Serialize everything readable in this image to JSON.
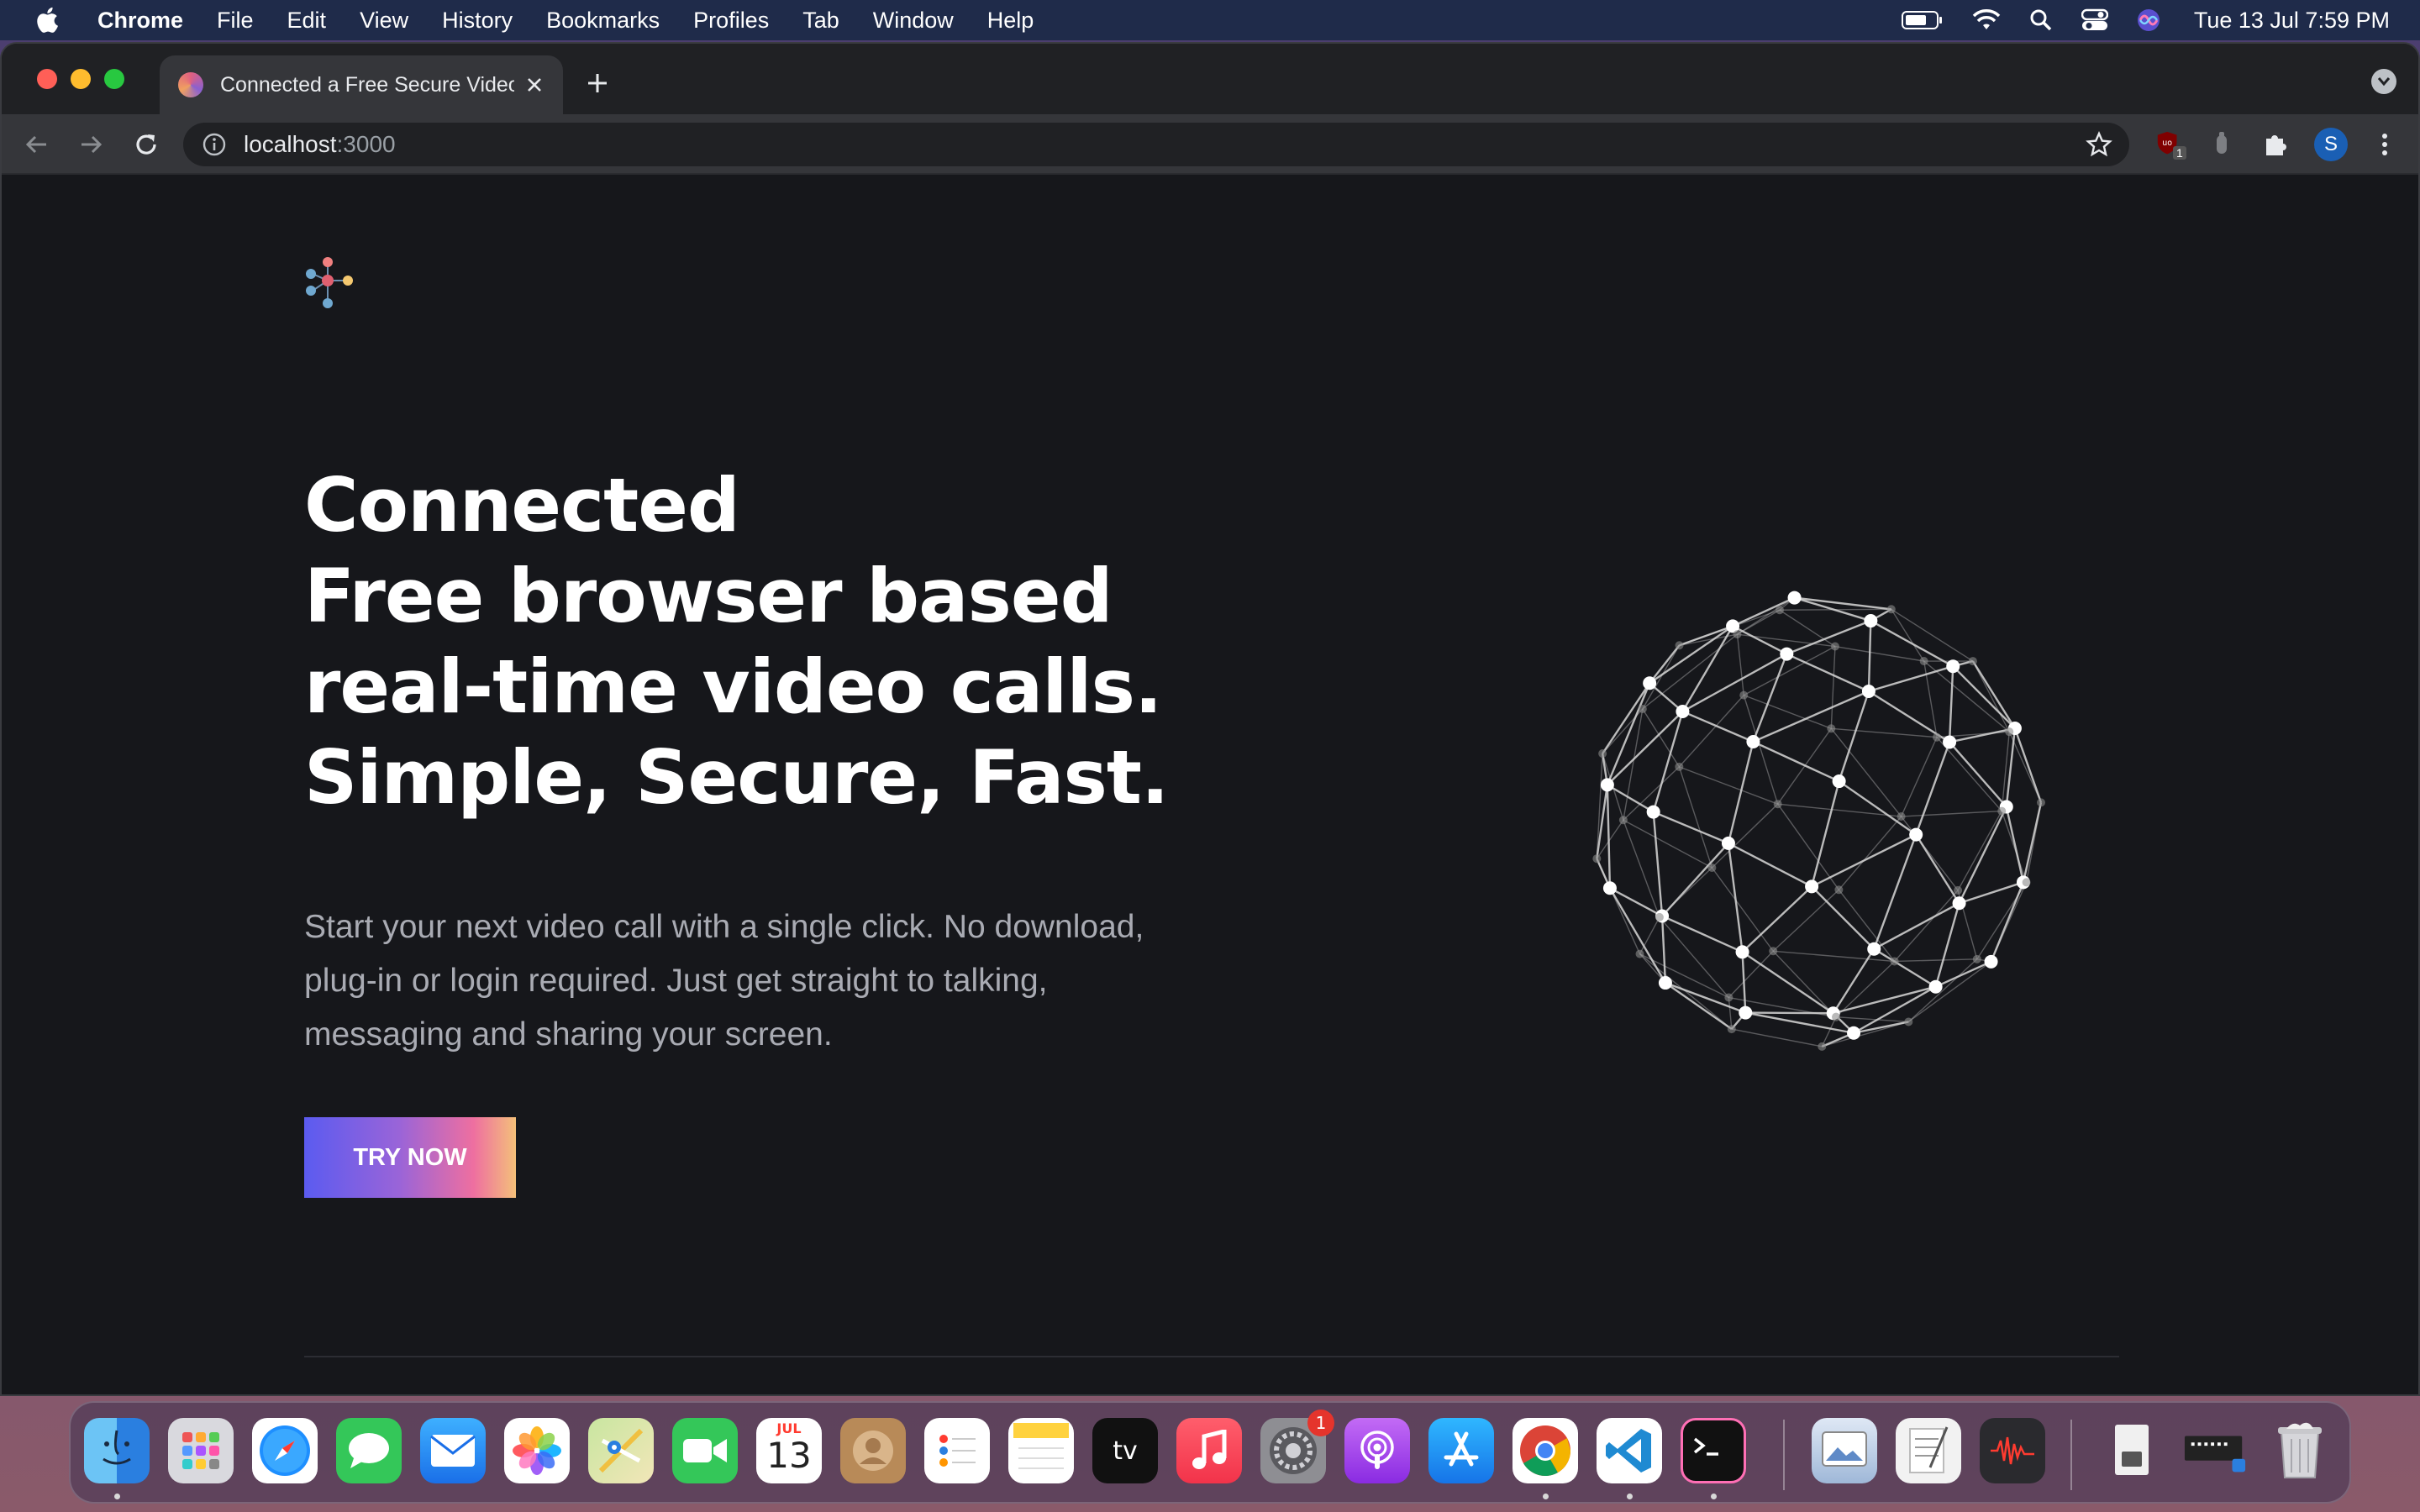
{
  "menubar": {
    "app": "Chrome",
    "items": [
      "File",
      "Edit",
      "View",
      "History",
      "Bookmarks",
      "Profiles",
      "Tab",
      "Window",
      "Help"
    ],
    "clock": "Tue 13 Jul  7:59 PM"
  },
  "browser": {
    "tab_title": "Connected a Free Secure Video",
    "url_host": "localhost",
    "url_port": ":3000",
    "profile_initial": "S",
    "ext_badge": "1"
  },
  "page": {
    "hero_lines": [
      "Connected",
      "Free browser based",
      "real-time video calls.",
      "Simple, Secure, Fast."
    ],
    "subtitle": "Start your next video call with a single click. No download, plug-in or login required. Just get straight to talking, messaging and sharing your screen.",
    "cta_label": "TRY NOW"
  },
  "dock": {
    "calendar_month": "JUL",
    "calendar_day": "13",
    "settings_badge": "1",
    "tv_label": "tv"
  },
  "colors": {
    "page_bg": "#16171b",
    "cta_gradient": [
      "#5b5bf0",
      "#9a64d8",
      "#ee6fa0",
      "#f4c07a"
    ],
    "subtitle": "#a9abb3"
  }
}
